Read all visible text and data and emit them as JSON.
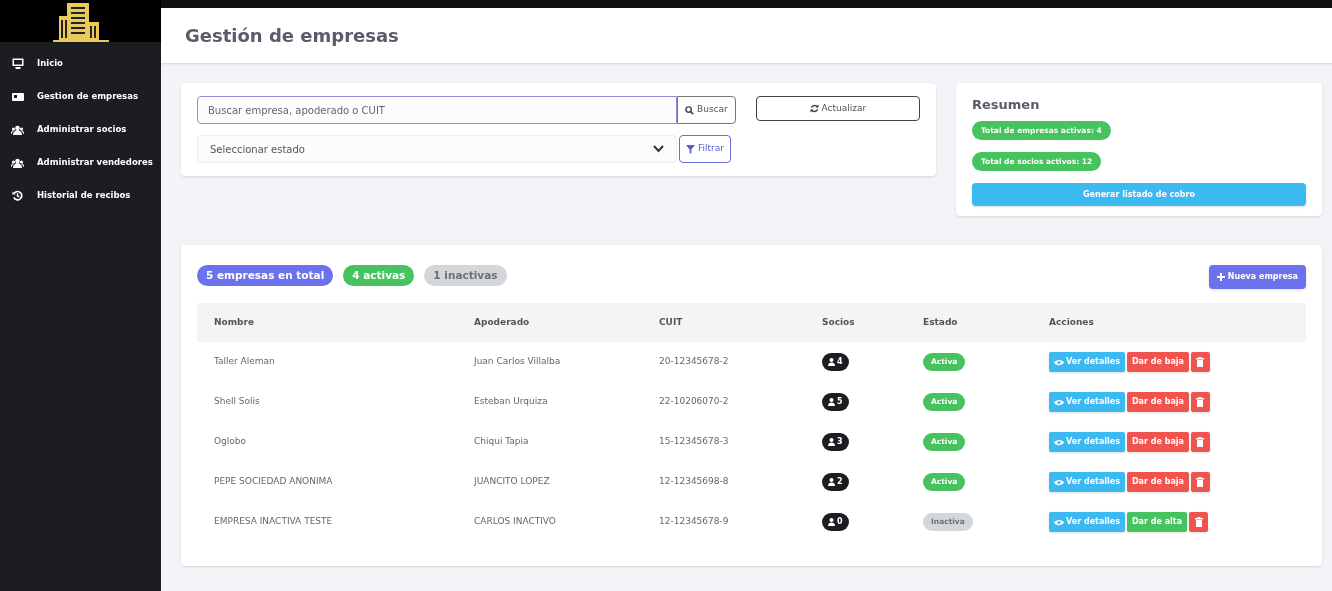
{
  "sidebar": {
    "items": [
      {
        "label": "Inicio",
        "kind": "monitor"
      },
      {
        "label": "Gestion de empresas",
        "kind": "card"
      },
      {
        "label": "Administrar socios",
        "kind": "users"
      },
      {
        "label": "Administrar vendedores",
        "kind": "users"
      },
      {
        "label": "Historial de recibos",
        "kind": "history"
      }
    ]
  },
  "header": {
    "title": "Gestión de empresas"
  },
  "filters": {
    "search": {
      "placeholder": "Buscar empresa, apoderado o CUIT",
      "button": "Buscar"
    },
    "refresh_button": "Actualizar",
    "status_select": {
      "placeholder": "Seleccionar estado"
    },
    "filter_button": "Filtrar"
  },
  "summary": {
    "title": "Resumen",
    "badges": [
      "Total de empresas activas: 4",
      "Total de socios activos: 12"
    ],
    "button": "Generar listado de cobro"
  },
  "counts": [
    {
      "label": "5 empresas en total",
      "kind": "total"
    },
    {
      "label": "4 activas",
      "kind": "active"
    },
    {
      "label": "1 inactivas",
      "kind": "inactive"
    }
  ],
  "new_button": "Nueva empresa",
  "table": {
    "columns": [
      "Nombre",
      "Apoderado",
      "CUIT",
      "Socios",
      "Estado",
      "Acciones"
    ],
    "rows": [
      {
        "name": "Taller Aleman",
        "agent": "Juan Carlos Villalba",
        "cuit": "20-12345678-2",
        "members": "4",
        "status": "Activa",
        "active": true,
        "details": "Ver detalles",
        "toggle": "Dar de baja"
      },
      {
        "name": "Shell Solis",
        "agent": "Esteban Urquiza",
        "cuit": "22-10206070-2",
        "members": "5",
        "status": "Activa",
        "active": true,
        "details": "Ver detalles",
        "toggle": "Dar de baja"
      },
      {
        "name": "Oglobo",
        "agent": "Chiqui Tapia",
        "cuit": "15-12345678-3",
        "members": "3",
        "status": "Activa",
        "active": true,
        "details": "Ver detalles",
        "toggle": "Dar de baja"
      },
      {
        "name": "PEPE SOCIEDAD ANONIMA",
        "agent": "JUANCITO LOPEZ",
        "cuit": "12-12345698-8",
        "members": "2",
        "status": "Activa",
        "active": true,
        "details": "Ver detalles",
        "toggle": "Dar de baja"
      },
      {
        "name": "EMPRESA INACTIVA TESTE",
        "agent": "CARLOS INACTIVO",
        "cuit": "12-12345678-9",
        "members": "0",
        "status": "Inactiva",
        "active": false,
        "details": "Ver detalles",
        "toggle": "Dar de alta"
      }
    ]
  }
}
